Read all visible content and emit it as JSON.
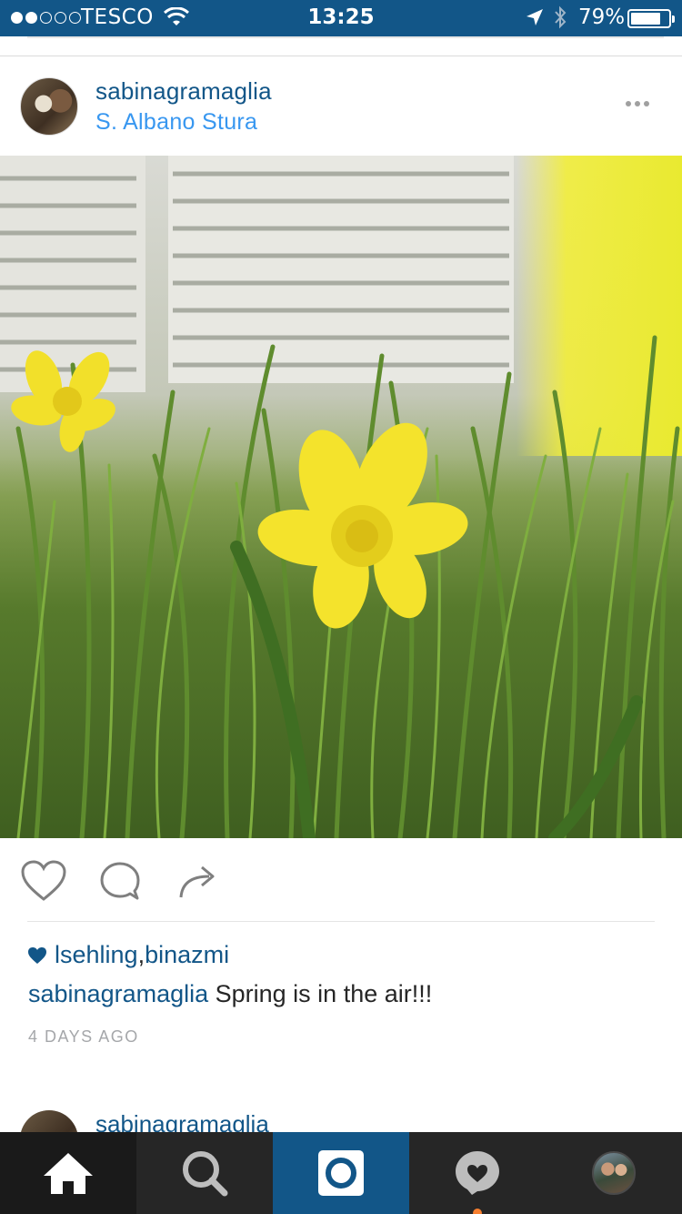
{
  "status_bar": {
    "carrier": "TESCO",
    "time": "13:25",
    "battery_percent": "79%",
    "battery_level": 0.79,
    "signal_bars": 2,
    "signal_total": 5
  },
  "post": {
    "username": "sabinagramaglia",
    "location": "S. Albano Stura",
    "photo_subject": "yellow-daffodils-in-grass",
    "likes": {
      "users": [
        "lsehling",
        "binazmi"
      ],
      "separator": ", "
    },
    "caption": {
      "username": "sabinagramaglia",
      "text": " Spring is in the air!!!"
    },
    "timestamp": "4 DAYS AGO"
  },
  "next_post": {
    "username": "sabinagramaglia"
  },
  "tabs": [
    {
      "name": "home",
      "icon": "home-icon",
      "active": true
    },
    {
      "name": "explore",
      "icon": "search-icon"
    },
    {
      "name": "camera",
      "icon": "camera-icon"
    },
    {
      "name": "activity",
      "icon": "activity-heart-icon",
      "notification": true
    },
    {
      "name": "profile",
      "icon": "profile-avatar"
    }
  ],
  "colors": {
    "brand_blue": "#125688",
    "link_blue": "#3897f0",
    "tab_bar": "#262626",
    "notification_dot": "#f77f2f"
  }
}
